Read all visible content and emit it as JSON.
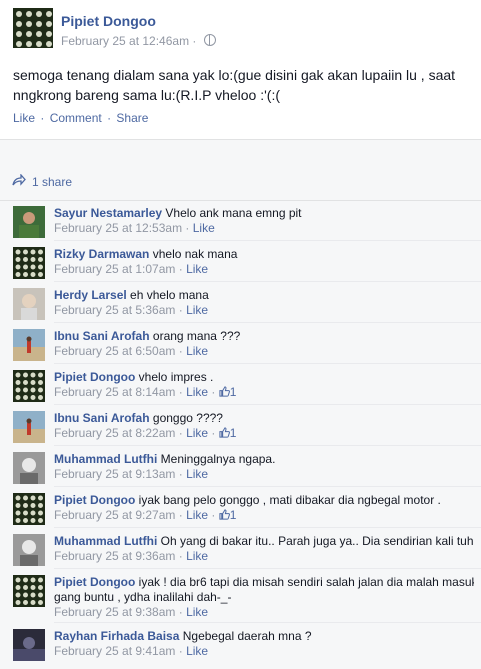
{
  "post": {
    "author": "Pipiet Dongoo",
    "timestamp": "February 25 at 12:46am",
    "separator": "·",
    "text": "semoga tenang dialam sana yak lo:(gue disini gak akan lupaiin lu , saat nngkrong bareng sama lu:(R.I.P vheloo :'(:(",
    "actions": {
      "like": "Like",
      "comment": "Comment",
      "share": "Share",
      "dot": "·"
    }
  },
  "shares": {
    "label": "1 share"
  },
  "comments": [
    {
      "name": "Sayur Nestamarley",
      "text": "Vhelo ank mana emng pit",
      "time": "February 25 at 12:53am",
      "like": "Like",
      "likes": "",
      "avatar": "green"
    },
    {
      "name": "Rizky Darmawan",
      "text": "vhelo nak mana",
      "time": "February 25 at 1:07am",
      "like": "Like",
      "likes": "",
      "avatar": "grid"
    },
    {
      "name": "Herdy Larsel",
      "text": "eh vhelo mana",
      "time": "February 25 at 5:36am",
      "like": "Like",
      "likes": "",
      "avatar": "light"
    },
    {
      "name": "Ibnu Sani Arofah",
      "text": "orang mana ???",
      "time": "February 25 at 6:50am",
      "like": "Like",
      "likes": "",
      "avatar": "beach"
    },
    {
      "name": "Pipiet Dongoo",
      "text": "vhelo impres .",
      "time": "February 25 at 8:14am",
      "like": "Like",
      "likes": "1",
      "avatar": "grid"
    },
    {
      "name": "Ibnu Sani Arofah",
      "text": "gonggo ????",
      "time": "February 25 at 8:22am",
      "like": "Like",
      "likes": "1",
      "avatar": "beach"
    },
    {
      "name": "Muhammad Lutfhi",
      "text": "Meninggalnya ngapa.",
      "time": "February 25 at 9:13am",
      "like": "Like",
      "likes": "",
      "avatar": "gray"
    },
    {
      "name": "Pipiet Dongoo",
      "text": "iyak bang pelo gonggo , mati dibakar dia ngbegal motor .",
      "time": "February 25 at 9:27am",
      "like": "Like",
      "likes": "1",
      "avatar": "grid"
    },
    {
      "name": "Muhammad Lutfhi",
      "text": "Oh yang di bakar itu.. Parah juga ya.. Dia sendirian kali tuh",
      "time": "February 25 at 9:36am",
      "like": "Like",
      "likes": "",
      "avatar": "gray"
    },
    {
      "name": "Pipiet Dongoo",
      "text": "iyak ! dia br6 tapi dia misah sendiri salah jalan dia malah masuk",
      "text2": "gang buntu , ydha inalilahi dah-_-",
      "time": "February 25 at 9:38am",
      "like": "Like",
      "likes": "",
      "avatar": "grid"
    },
    {
      "name": "Rayhan Firhada Baisa",
      "text": "Ngebegal daerah mna ?",
      "time": "February 25 at 9:41am",
      "like": "Like",
      "likes": "",
      "avatar": "dark"
    }
  ],
  "colors": {
    "link": "#3b5998",
    "meta": "#9197a3",
    "panel": "#f6f7f8"
  }
}
